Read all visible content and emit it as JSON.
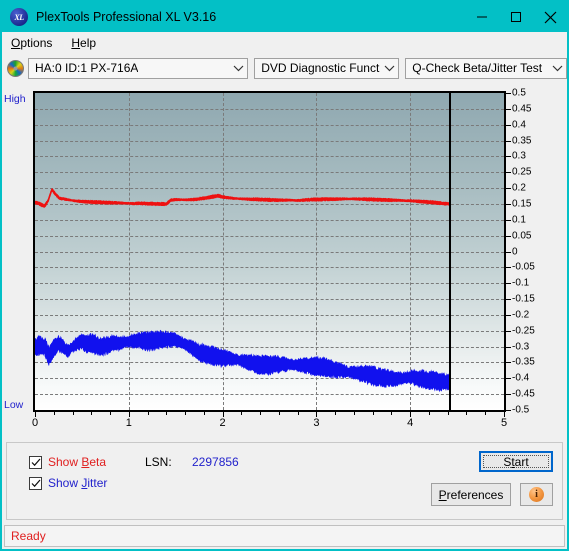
{
  "window": {
    "title": "PlexTools Professional XL V3.16",
    "app_icon": "xl-logo-icon",
    "minimize": "–",
    "maximize": "□",
    "close": "✕"
  },
  "menubar": {
    "items": [
      {
        "label": "Options",
        "accel": "O"
      },
      {
        "label": "Help",
        "accel": "H"
      }
    ]
  },
  "toolbar": {
    "disc_icon": "optical-disc-icon",
    "drive_select": "HA:0 ID:1  PX-716A",
    "function_select": "DVD Diagnostic Functions",
    "test_select": "Q-Check Beta/Jitter Test",
    "arrow": "⌄"
  },
  "chart_labels": {
    "high": "High",
    "low": "Low"
  },
  "controls": {
    "show_beta": "Show Beta",
    "show_beta_checked": true,
    "show_jitter": "Show Jitter",
    "show_jitter_checked": true,
    "lsn_label": "LSN:",
    "lsn_value": "2297856",
    "start": "Start",
    "preferences": "Preferences",
    "info_icon": "info-icon",
    "info_glyph": "i"
  },
  "statusbar": {
    "text": "Ready"
  },
  "colors": {
    "titlebar": "#03c0c6",
    "beta_trace": "#ee1111",
    "jitter_trace": "#1111ee",
    "axis_label_blue": "#2222cc",
    "status_red": "#e02020"
  },
  "chart_data": {
    "type": "line",
    "title": "Q-Check Beta/Jitter Test",
    "xlabel": "",
    "ylabel": "",
    "xlim": [
      0,
      5
    ],
    "ylim": [
      -0.5,
      0.5
    ],
    "xticks": [
      0,
      1,
      2,
      3,
      4,
      5
    ],
    "yticks": [
      0.5,
      0.45,
      0.4,
      0.35,
      0.3,
      0.25,
      0.2,
      0.15,
      0.1,
      0.05,
      0,
      -0.05,
      -0.1,
      -0.15,
      -0.2,
      -0.25,
      -0.3,
      -0.35,
      -0.4,
      -0.45,
      -0.5
    ],
    "ytick_labels": [
      "0.5",
      "0.45",
      "0.4",
      "0.35",
      "0.3",
      "0.25",
      "0.2",
      "0.15",
      "0.1",
      "0.05",
      "0",
      "-0.05",
      "-0.1",
      "-0.15",
      "-0.2",
      "-0.25",
      "-0.3",
      "-0.35",
      "-0.4",
      "-0.45",
      "-0.5"
    ],
    "grid": true,
    "left_axis_annotations": [
      "High",
      "Low"
    ],
    "data_end_marker_x": 4.42,
    "legend_position": "below-chart",
    "series": [
      {
        "name": "Show Beta",
        "color": "#ee1111",
        "x": [
          0.0,
          0.05,
          0.1,
          0.14,
          0.18,
          0.22,
          0.26,
          0.3,
          0.36,
          0.42,
          0.5,
          0.6,
          0.7,
          0.8,
          0.9,
          1.0,
          1.05,
          1.1,
          1.2,
          1.3,
          1.4,
          1.45,
          1.5,
          1.6,
          1.7,
          1.8,
          1.9,
          1.95,
          2.0,
          2.1,
          2.2,
          2.3,
          2.4,
          2.5,
          2.6,
          2.7,
          2.8,
          2.9,
          3.0,
          3.1,
          3.2,
          3.3,
          3.4,
          3.5,
          3.6,
          3.7,
          3.8,
          3.9,
          4.0,
          4.1,
          4.2,
          4.3,
          4.42
        ],
        "y": [
          0.155,
          0.15,
          0.143,
          0.16,
          0.196,
          0.18,
          0.168,
          0.166,
          0.163,
          0.16,
          0.158,
          0.156,
          0.155,
          0.154,
          0.153,
          0.152,
          0.151,
          0.152,
          0.151,
          0.15,
          0.15,
          0.162,
          0.164,
          0.163,
          0.164,
          0.168,
          0.173,
          0.176,
          0.172,
          0.168,
          0.166,
          0.165,
          0.164,
          0.163,
          0.162,
          0.162,
          0.161,
          0.163,
          0.164,
          0.165,
          0.165,
          0.166,
          0.166,
          0.165,
          0.164,
          0.163,
          0.162,
          0.161,
          0.16,
          0.158,
          0.156,
          0.153,
          0.15
        ],
        "band_half_width": 0.006,
        "note": "Beta value stays roughly flat near 0.15-0.17 with a spike to ~0.20 near x=0.2"
      },
      {
        "name": "Show Jitter",
        "color": "#1111ee",
        "x": [
          0.0,
          0.05,
          0.1,
          0.15,
          0.2,
          0.25,
          0.3,
          0.35,
          0.4,
          0.45,
          0.5,
          0.55,
          0.6,
          0.65,
          0.7,
          0.75,
          0.8,
          0.85,
          0.9,
          0.95,
          1.0,
          1.05,
          1.1,
          1.15,
          1.2,
          1.25,
          1.3,
          1.35,
          1.4,
          1.45,
          1.5,
          1.55,
          1.6,
          1.65,
          1.7,
          1.75,
          1.8,
          1.85,
          1.9,
          1.95,
          2.0,
          2.1,
          2.2,
          2.3,
          2.4,
          2.5,
          2.6,
          2.7,
          2.8,
          2.9,
          3.0,
          3.1,
          3.2,
          3.3,
          3.4,
          3.5,
          3.6,
          3.7,
          3.8,
          3.9,
          4.0,
          4.1,
          4.2,
          4.3,
          4.42
        ],
        "y": [
          -0.305,
          -0.295,
          -0.3,
          -0.33,
          -0.305,
          -0.29,
          -0.3,
          -0.315,
          -0.3,
          -0.29,
          -0.285,
          -0.292,
          -0.288,
          -0.295,
          -0.3,
          -0.297,
          -0.292,
          -0.288,
          -0.29,
          -0.286,
          -0.284,
          -0.282,
          -0.28,
          -0.282,
          -0.284,
          -0.282,
          -0.28,
          -0.278,
          -0.276,
          -0.278,
          -0.28,
          -0.285,
          -0.292,
          -0.3,
          -0.31,
          -0.318,
          -0.322,
          -0.326,
          -0.33,
          -0.334,
          -0.336,
          -0.338,
          -0.344,
          -0.352,
          -0.358,
          -0.358,
          -0.356,
          -0.356,
          -0.358,
          -0.36,
          -0.362,
          -0.366,
          -0.372,
          -0.378,
          -0.382,
          -0.386,
          -0.392,
          -0.398,
          -0.402,
          -0.4,
          -0.396,
          -0.4,
          -0.406,
          -0.41,
          -0.412
        ],
        "band_half_width": 0.032,
        "note": "Dense noisy jitter band drifting from about -0.28 down to about -0.41"
      }
    ]
  }
}
